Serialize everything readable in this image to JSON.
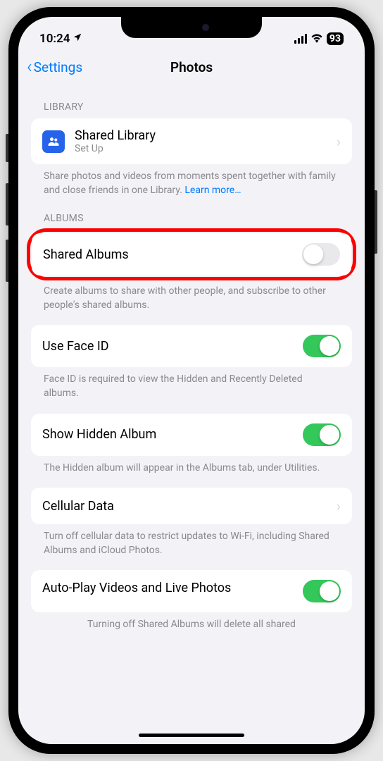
{
  "status": {
    "time": "10:24",
    "battery": "93"
  },
  "nav": {
    "back_label": "Settings",
    "title": "Photos"
  },
  "sections": {
    "library": {
      "header": "LIBRARY",
      "shared_library": {
        "title": "Shared Library",
        "subtitle": "Set Up"
      },
      "footer": "Share photos and videos from moments spent together with family and close friends in one Library.",
      "learn_more": "Learn more…"
    },
    "albums": {
      "header": "ALBUMS",
      "shared_albums": {
        "title": "Shared Albums",
        "enabled": false
      },
      "footer": "Create albums to share with other people, and subscribe to other people's shared albums."
    },
    "face_id": {
      "title": "Use Face ID",
      "enabled": true,
      "footer": "Face ID is required to view the Hidden and Recently Deleted albums."
    },
    "hidden_album": {
      "title": "Show Hidden Album",
      "enabled": true,
      "footer": "The Hidden album will appear in the Albums tab, under Utilities."
    },
    "cellular": {
      "title": "Cellular Data",
      "footer": "Turn off cellular data to restrict updates to Wi-Fi, including Shared Albums and iCloud Photos."
    },
    "autoplay": {
      "title": "Auto-Play Videos and Live Photos",
      "enabled": true,
      "footer": "Turning off Shared Albums will delete all shared"
    }
  }
}
